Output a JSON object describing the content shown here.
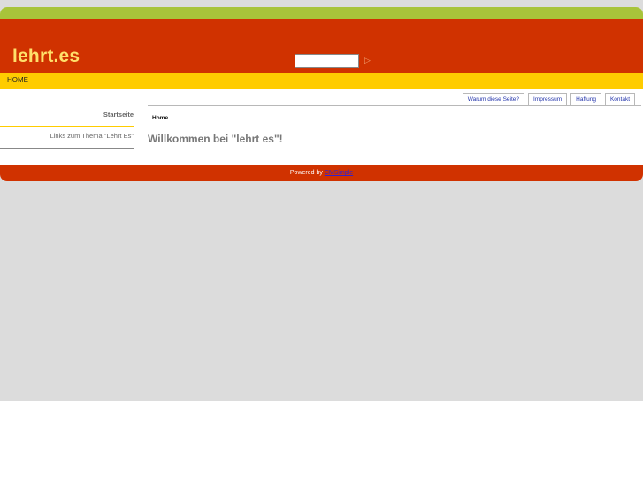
{
  "header": {
    "logo_text": "lehrt.es",
    "search": {
      "value": "",
      "placeholder": ""
    },
    "search_button_label": "▷"
  },
  "nav": {
    "home_label": "HOME"
  },
  "tabs": [
    {
      "label": "Warum diese Seite?"
    },
    {
      "label": "Impressum"
    },
    {
      "label": "Haftung"
    },
    {
      "label": "Kontakt"
    }
  ],
  "sidebar": {
    "items": [
      {
        "label": "Startseite"
      },
      {
        "label": "Links zum Thema \"Lehrt Es\""
      }
    ]
  },
  "main": {
    "breadcrumb": "Home",
    "welcome": "Willkommen bei \"lehrt es\"!"
  },
  "footer": {
    "powered_by": "Powered by",
    "cms_link": "CMSimple"
  },
  "colors": {
    "top_bar": "#a8c43a",
    "header": "#d03200",
    "navbar": "#ffcc00",
    "logo": "#ffe06a"
  }
}
